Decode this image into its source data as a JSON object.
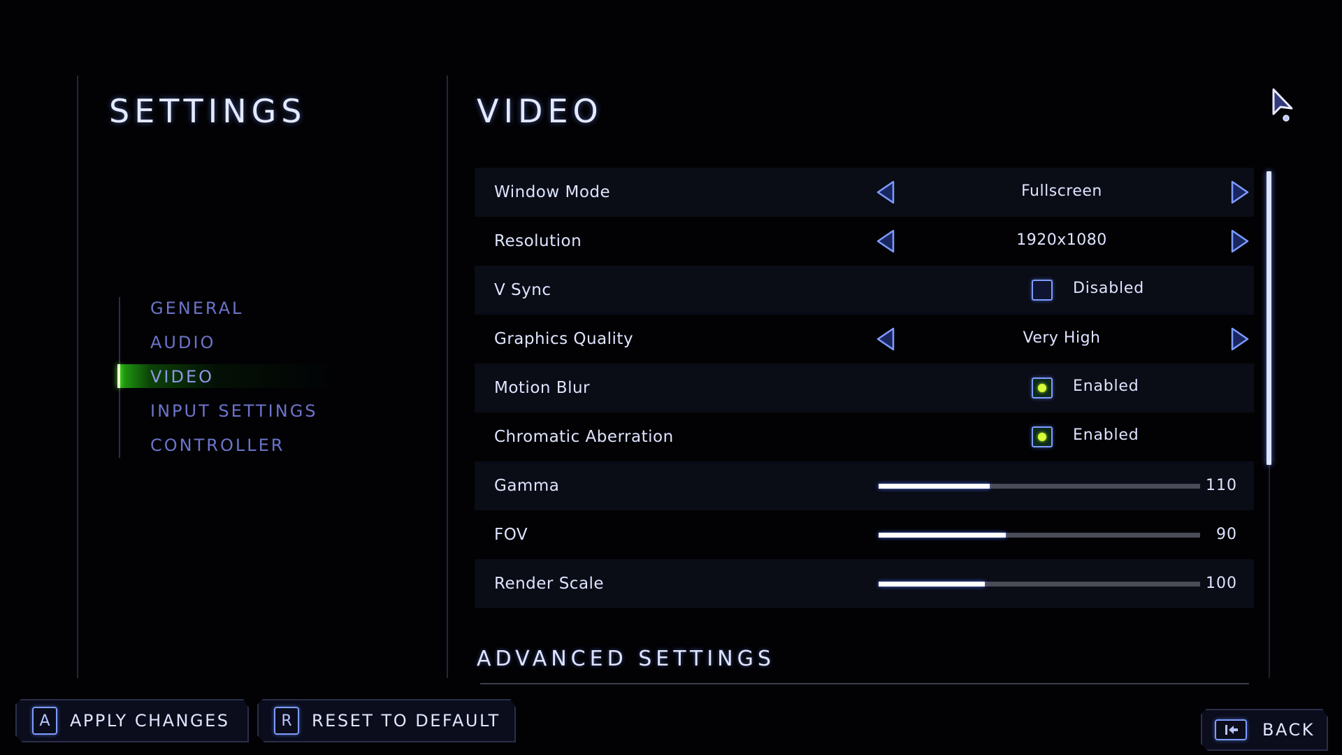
{
  "sidebar": {
    "title": "SETTINGS",
    "items": [
      {
        "label": "GENERAL",
        "active": false
      },
      {
        "label": "AUDIO",
        "active": false
      },
      {
        "label": "VIDEO",
        "active": true
      },
      {
        "label": "INPUT SETTINGS",
        "active": false
      },
      {
        "label": "CONTROLLER",
        "active": false
      }
    ]
  },
  "main": {
    "title": "VIDEO",
    "settings": [
      {
        "label": "Window Mode",
        "type": "selector",
        "value": "Fullscreen"
      },
      {
        "label": "Resolution",
        "type": "selector",
        "value": "1920x1080"
      },
      {
        "label": "V Sync",
        "type": "checkbox",
        "checked": false,
        "value": "Disabled"
      },
      {
        "label": "Graphics Quality",
        "type": "selector",
        "value": "Very High"
      },
      {
        "label": "Motion Blur",
        "type": "checkbox",
        "checked": true,
        "value": "Enabled"
      },
      {
        "label": "Chromatic Aberration",
        "type": "checkbox",
        "checked": true,
        "value": "Enabled"
      },
      {
        "label": "Gamma",
        "type": "slider",
        "value": "110",
        "fill_fraction": 0.345
      },
      {
        "label": "FOV",
        "type": "slider",
        "value": "90",
        "fill_fraction": 0.395
      },
      {
        "label": "Render Scale",
        "type": "slider",
        "value": "100",
        "fill_fraction": 0.33
      }
    ],
    "advanced_title": "ADVANCED SETTINGS"
  },
  "footer": {
    "apply": {
      "key": "A",
      "label": "APPLY CHANGES"
    },
    "reset": {
      "key": "R",
      "label": "RESET TO DEFAULT"
    },
    "back": {
      "label": "BACK",
      "icon": "back-arrow-icon"
    }
  },
  "colors": {
    "accent_blue": "#7d9cff",
    "active_green": "#7cff3a",
    "checkbox_dot": "#d9ff38",
    "nav_text": "#6c74c9",
    "text": "#dfe4ff"
  }
}
